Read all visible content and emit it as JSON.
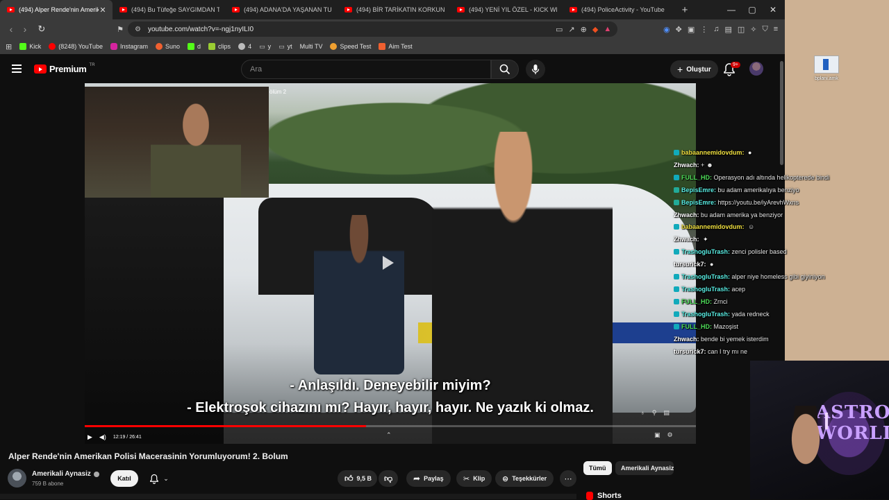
{
  "browser": {
    "tabs": [
      {
        "label": "(494) Alper Rende'nin Amerik",
        "active": true
      },
      {
        "label": "(494) Bu Tüfeğe SAYGIMDAN Takım E",
        "active": false
      },
      {
        "label": "(494) ADANA'DA YAŞANAN TUHAF O",
        "active": false
      },
      {
        "label": "(494) BİR TARİKATIN KORKUNÇ SONU",
        "active": false
      },
      {
        "label": "(494) YENİ YIL ÖZEL - KICK WRAPPED",
        "active": false
      },
      {
        "label": "(494) PoliceActivity - YouTube",
        "active": false
      }
    ],
    "new_tab": "+",
    "window_controls": {
      "minimize": "—",
      "maximize": "▢",
      "close": "✕"
    },
    "url": "youtube.com/watch?v=-ngj1nyILI0",
    "bookmarks": [
      {
        "label": "Kick",
        "color": "#53fc18"
      },
      {
        "label": "(8248) YouTube",
        "color": "#ff0000"
      },
      {
        "label": "Instagram",
        "color": "#d6249f"
      },
      {
        "label": "Suno",
        "color": "#f06030"
      },
      {
        "label": "d",
        "color": "#53fc18"
      },
      {
        "label": "clips",
        "color": "#9acd32"
      },
      {
        "label": "4",
        "color": "#bbbbbb"
      },
      {
        "label": "y",
        "color": "#888888"
      },
      {
        "label": "yt",
        "color": "#888888"
      },
      {
        "label": "Multi TV",
        "color": "#888888"
      },
      {
        "label": "Speed Test",
        "color": "#f0a030"
      },
      {
        "label": "Aim Test",
        "color": "#f06030"
      }
    ]
  },
  "youtube": {
    "logo_text": "Premium",
    "logo_region": "TR",
    "search_placeholder": "Ara",
    "create_label": "Oluştur",
    "notification_badge": "9+",
    "accent": "#ff0000"
  },
  "video": {
    "pip_label": "ölüm 2",
    "subtitle_line1": "- Anlaşıldı. Deneyebilir miyim?",
    "subtitle_line2": "- Elektroşok cihazını mı? Hayır, hayır, hayır. Ne yazık ki olmaz.",
    "time": "12:19 / 26:41",
    "progress_fraction": 0.46
  },
  "chat": [
    {
      "user": "babaannemidovdum",
      "msg": "",
      "color": "u-yellow",
      "badge": "chat-badge",
      "emote": "●"
    },
    {
      "user": "Zhwach",
      "msg": "+",
      "color": "u-white",
      "badge": "",
      "emote": "☻"
    },
    {
      "user": "FULL_HD",
      "msg": "Operasyon adı altında helikopterede bindi",
      "color": "u-green",
      "badge": "chat-badge",
      "emote": ""
    },
    {
      "user": "BepisEmre",
      "msg": "bu adam amerikalıya benziyo",
      "color": "u-cyan",
      "badge": "chat-badge g",
      "emote": ""
    },
    {
      "user": "BepisEmre",
      "msg": "https://youtu.be/iyArevhWxns",
      "color": "u-cyan",
      "badge": "chat-badge g",
      "emote": ""
    },
    {
      "user": "Zhwach",
      "msg": "bu adam amerika ya benziyor",
      "color": "u-white",
      "badge": "",
      "emote": ""
    },
    {
      "user": "babaannemidovdum",
      "msg": "",
      "color": "u-yellow",
      "badge": "chat-badge",
      "emote": "☺"
    },
    {
      "user": "Zhwach",
      "msg": "",
      "color": "u-white",
      "badge": "",
      "emote": "✦"
    },
    {
      "user": "TrashogluTrash",
      "msg": "zenci polisler based",
      "color": "u-cyan",
      "badge": "chat-badge",
      "emote": ""
    },
    {
      "user": "tursurick7",
      "msg": "",
      "color": "u-white",
      "badge": "",
      "emote": "●"
    },
    {
      "user": "TrashogluTrash",
      "msg": "alper niye homeless gibi giyiniyon",
      "color": "u-cyan",
      "badge": "chat-badge",
      "emote": ""
    },
    {
      "user": "TrashogluTrash",
      "msg": "acep",
      "color": "u-cyan",
      "badge": "chat-badge",
      "emote": ""
    },
    {
      "user": "FULL_HD",
      "msg": "Zrnci",
      "color": "u-green",
      "badge": "chat-badge",
      "emote": ""
    },
    {
      "user": "TrashogluTrash",
      "msg": "yada redneck",
      "color": "u-cyan",
      "badge": "chat-badge",
      "emote": ""
    },
    {
      "user": "FULL_HD",
      "msg": "Mazoşist",
      "color": "u-green",
      "badge": "chat-badge",
      "emote": ""
    },
    {
      "user": "Zhwach",
      "msg": "bende bi yemek isterdim",
      "color": "u-white",
      "badge": "",
      "emote": ""
    },
    {
      "user": "tursurick7",
      "msg": "can I try mı ne",
      "color": "u-white",
      "badge": "",
      "emote": ""
    }
  ],
  "desktop": {
    "icon_label": "bplani.amk",
    "webcam_poster_text": "ASTRO WORLD"
  },
  "below": {
    "title": "Alper Rende'nin Amerikan Polisi Macerasinin Yorumluyorum! 2. Bolum",
    "channel": "Amerikali Aynasiz",
    "subscribers": "759 B abone",
    "join": "Katıl",
    "likes": "9,5 B",
    "share": "Paylaş",
    "clip": "Klip",
    "thanks": "Teşekkürler",
    "more": "⋯",
    "chips": [
      "Tümü",
      "Amerikali Aynasiz"
    ],
    "shorts": "Shorts"
  }
}
